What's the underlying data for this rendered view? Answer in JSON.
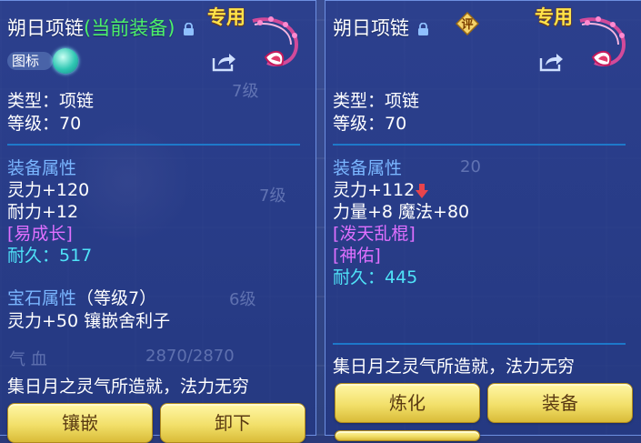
{
  "left_panel": {
    "item_name": "朔日项链",
    "equipped_tag": "(当前装备)",
    "ribbon": "专用",
    "icon_toggle_label": "图标",
    "type_line": "类型：项链",
    "level_line": "等级：70",
    "attr_header": "装备属性",
    "attrs": [
      "灵力+120",
      "耐力+12"
    ],
    "special": "[易成长]",
    "durability": "耐久：517",
    "gem_header": "宝石属性",
    "gem_level": "（等级7）",
    "gem_line": "灵力+50 镶嵌舍利子",
    "description": "集日月之灵气所造就，法力无穷",
    "buttons": [
      "镶嵌",
      "卸下"
    ],
    "bg_text": [
      "7级",
      "7级",
      "6级",
      "气 血",
      "2870/2870"
    ]
  },
  "right_panel": {
    "item_name": "朔日项链",
    "ribbon": "专用",
    "grade_badge": "评",
    "type_line": "类型：项链",
    "level_line": "等级：70",
    "attr_header": "装备属性",
    "attr_line1": "灵力+112",
    "attr_line2": "力量+8 魔法+80",
    "special1": "[泼天乱棍]",
    "special2": "[神佑]",
    "durability": "耐久：445",
    "description": "集日月之灵气所造就，法力无穷",
    "buttons": [
      "炼化",
      "装备"
    ],
    "bg_text": [
      "20"
    ]
  },
  "colors": {
    "header_blue": "#7ab6ff",
    "equipped_green": "#4cf06a",
    "special_purple": "#e070ff",
    "durability_cyan": "#4fe3f8",
    "ribbon_yellow": "#ffe34a",
    "down_arrow_red": "#e8444c"
  },
  "icons": [
    "lock-icon",
    "share-icon",
    "necklace-emblem-icon",
    "down-arrow-icon",
    "grade-badge-icon"
  ]
}
